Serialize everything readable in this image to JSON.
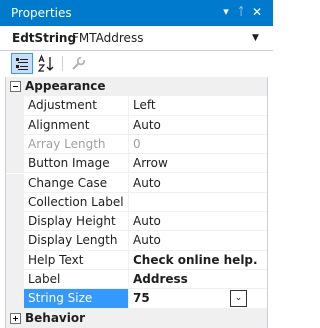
{
  "window": {
    "title": "Properties",
    "dropdown_glyph": "▾",
    "pin_glyph": "ᛏ",
    "close_glyph": "✕"
  },
  "selector": {
    "object_name": "EdtString",
    "object_type": "FMTAddress",
    "arrow_glyph": "▼"
  },
  "toolbar": {
    "icons": [
      "categorized-icon",
      "alphabetical-icon",
      "property-pages-icon"
    ]
  },
  "categories": [
    {
      "label": "Appearance",
      "expanded": true,
      "properties": [
        {
          "name": "Adjustment",
          "value": "Left"
        },
        {
          "name": "Alignment",
          "value": "Auto"
        },
        {
          "name": "Array Length",
          "value": "0",
          "disabled": true
        },
        {
          "name": "Button Image",
          "value": "Arrow"
        },
        {
          "name": "Change Case",
          "value": "Auto"
        },
        {
          "name": "Collection Label",
          "value": ""
        },
        {
          "name": "Display Height",
          "value": "Auto"
        },
        {
          "name": "Display Length",
          "value": "Auto"
        },
        {
          "name": "Help Text",
          "value": "Check online help.",
          "bold": true
        },
        {
          "name": "Label",
          "value": "Address",
          "bold": true
        },
        {
          "name": "String Size",
          "value": "75",
          "selected": true,
          "dropdown_glyph": "⌄"
        }
      ]
    },
    {
      "label": "Behavior",
      "expanded": false,
      "properties": []
    }
  ],
  "colors": {
    "title_bar": "#007acc",
    "selected_row": "#3399ff",
    "category_background": "#f0f0f0",
    "disabled_text": "#a0a0a0"
  }
}
